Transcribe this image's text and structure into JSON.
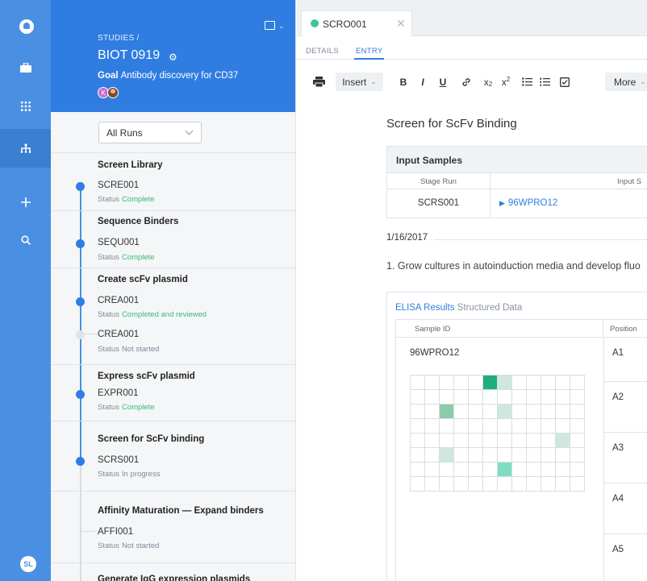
{
  "rail": {
    "items": [
      {
        "name": "logo",
        "icon": "logo-icon"
      },
      {
        "name": "inventory",
        "icon": "briefcase-icon"
      },
      {
        "name": "apps",
        "icon": "grid-icon"
      },
      {
        "name": "projects",
        "icon": "hierarchy-icon",
        "active": true
      },
      {
        "name": "create",
        "icon": "plus-icon"
      },
      {
        "name": "search",
        "icon": "search-icon"
      }
    ],
    "user_initials": "SL"
  },
  "study": {
    "breadcrumb": "STUDIES /",
    "title": "BIOT 0919",
    "goal_label": "Goal",
    "goal_text": "Antibody discovery for CD37",
    "member_initial": "K"
  },
  "runs_filter": {
    "selected": "All Runs"
  },
  "stages": [
    {
      "title": "Screen Library",
      "runs": [
        {
          "name": "SCRE001",
          "status_label": "Status",
          "status": "Complete"
        }
      ]
    },
    {
      "title": "Sequence Binders",
      "runs": [
        {
          "name": "SEQU001",
          "status_label": "Status",
          "status": "Complete"
        }
      ]
    },
    {
      "title": "Create scFv plasmid",
      "runs": [
        {
          "name": "CREA001",
          "status_label": "Status",
          "status": "Completed and reviewed"
        },
        {
          "name": "CREA001",
          "status_label": "Status",
          "status": "Not started"
        }
      ]
    },
    {
      "title": "Express scFv plasmid",
      "runs": [
        {
          "name": "EXPR001",
          "status_label": "Status",
          "status": "Complete"
        }
      ]
    },
    {
      "title": "Screen for ScFv binding",
      "runs": [
        {
          "name": "SCRS001",
          "status_label": "Status",
          "status": "In progress"
        }
      ]
    },
    {
      "title": "Affinity Maturation — Expand binders",
      "runs": [
        {
          "name": "AFFI001",
          "status_label": "Status",
          "status": "Not started"
        }
      ]
    },
    {
      "title": "Generate IgG expression plasmids",
      "runs": []
    }
  ],
  "colors": {
    "accent": "#2f7de1",
    "rail": "#4a90e2",
    "status_complete": "#3cb878",
    "tab_dot": "#41c49a"
  },
  "document": {
    "tab_label": "SCRO001",
    "subtabs": [
      "DETAILS",
      "ENTRY"
    ],
    "active_subtab": "ENTRY",
    "toolbar": {
      "insert_label": "Insert",
      "bold": "B",
      "italic": "I",
      "underline": "U",
      "subscript": "x",
      "subscript_sub": "2",
      "superscript": "x",
      "superscript_sup": "2",
      "more_label": "More"
    },
    "title": "Screen for ScFv Binding",
    "input_samples": {
      "heading": "Input Samples",
      "col_stage_run": "Stage Run",
      "col_input": "Input S",
      "row_stage_run": "SCRS001",
      "row_input": "96WPRO12"
    },
    "date": "1/16/2017",
    "step1": "1. Grow cultures in autoinduction media and develop fluo",
    "elisa": {
      "title": "ELISA Results",
      "subtitle": "Structured Data",
      "col_sample": "Sample ID",
      "col_position": "Position",
      "sample_id": "96WPRO12",
      "positions": [
        "A1",
        "A2",
        "A3",
        "A4",
        "A5"
      ]
    }
  }
}
